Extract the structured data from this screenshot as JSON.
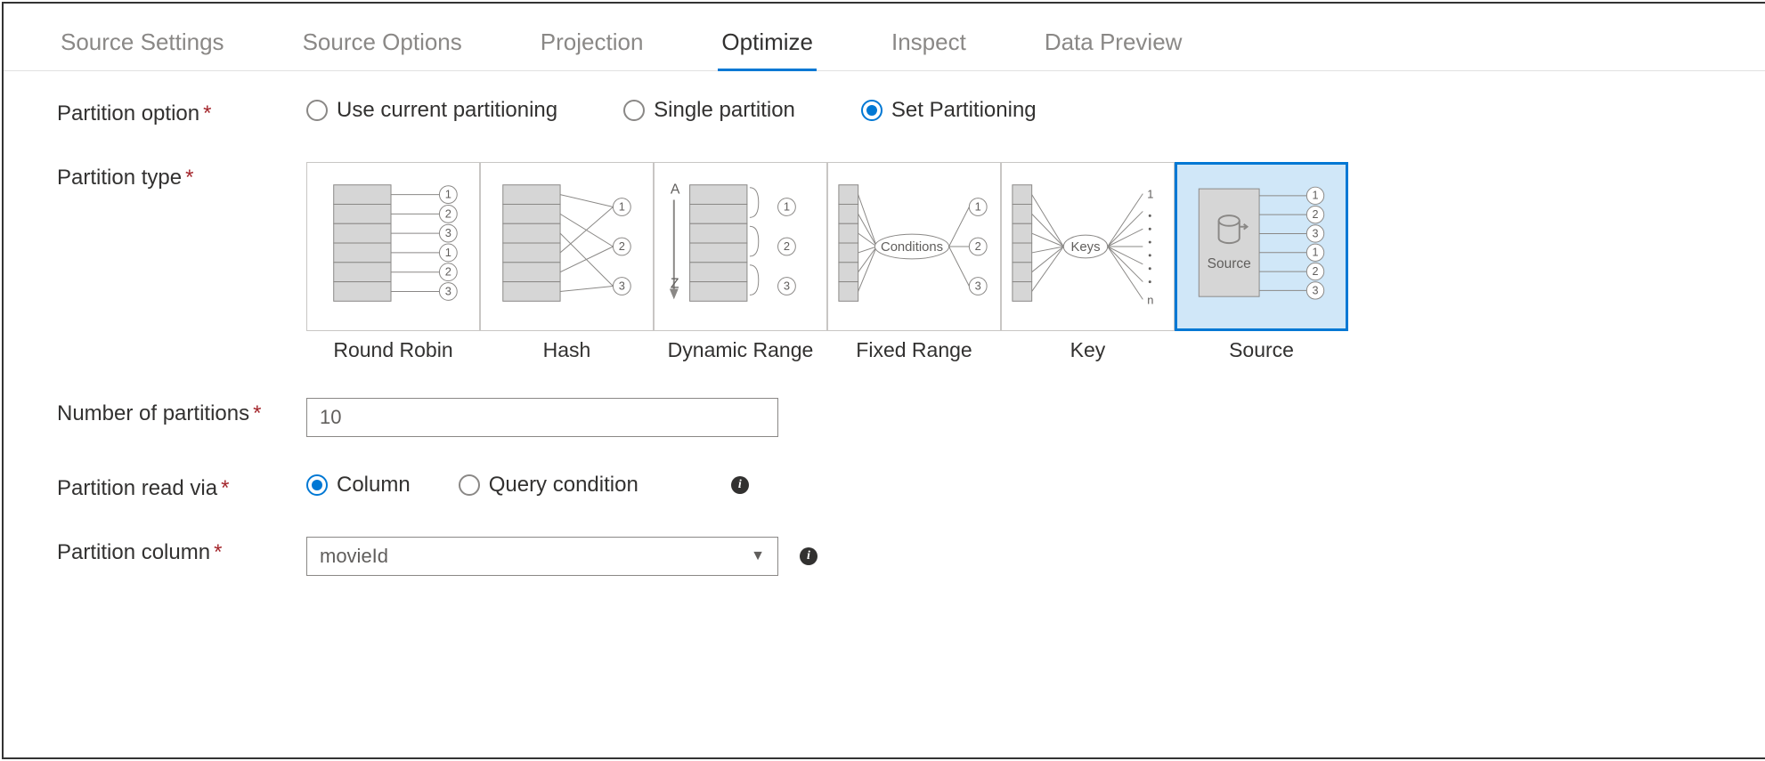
{
  "tabs": {
    "items": [
      {
        "label": "Source Settings",
        "active": false
      },
      {
        "label": "Source Options",
        "active": false
      },
      {
        "label": "Projection",
        "active": false
      },
      {
        "label": "Optimize",
        "active": true
      },
      {
        "label": "Inspect",
        "active": false
      },
      {
        "label": "Data Preview",
        "active": false
      }
    ]
  },
  "form": {
    "partition_option": {
      "label": "Partition option",
      "required": true,
      "options": [
        {
          "label": "Use current partitioning",
          "selected": false
        },
        {
          "label": "Single partition",
          "selected": false
        },
        {
          "label": "Set Partitioning",
          "selected": true
        }
      ]
    },
    "partition_type": {
      "label": "Partition type",
      "required": true,
      "types": [
        {
          "label": "Round Robin",
          "selected": false
        },
        {
          "label": "Hash",
          "selected": false
        },
        {
          "label": "Dynamic Range",
          "selected": false
        },
        {
          "label": "Fixed Range",
          "selected": false
        },
        {
          "label": "Key",
          "selected": false
        },
        {
          "label": "Source",
          "selected": true
        }
      ]
    },
    "num_partitions": {
      "label": "Number of partitions",
      "required": true,
      "value": "10"
    },
    "partition_read_via": {
      "label": "Partition read via",
      "required": true,
      "options": [
        {
          "label": "Column",
          "selected": true
        },
        {
          "label": "Query condition",
          "selected": false
        }
      ]
    },
    "partition_column": {
      "label": "Partition column",
      "required": true,
      "value": "movieId"
    }
  },
  "illust": {
    "fixed_range_text": "Conditions",
    "key_text": "Keys",
    "source_text": "Source"
  }
}
